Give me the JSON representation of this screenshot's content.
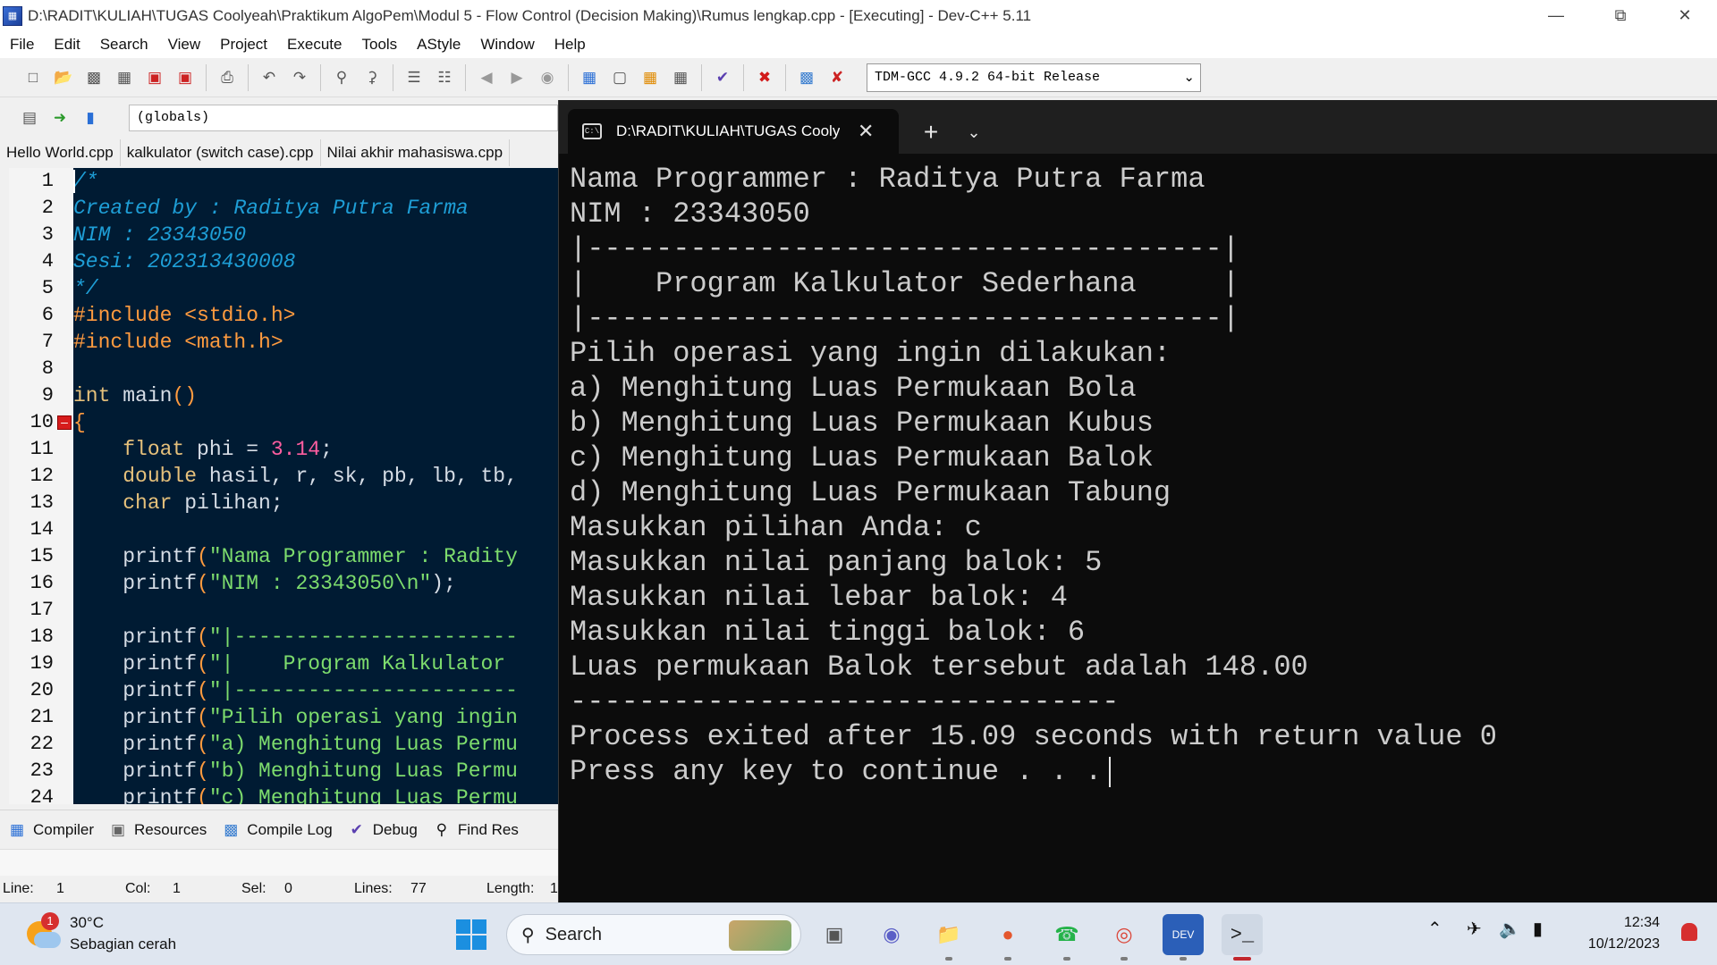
{
  "window": {
    "title": "D:\\RADIT\\KULIAH\\TUGAS Coolyeah\\Praktikum AlgoPem\\Modul 5 - Flow Control (Decision Making)\\Rumus lengkap.cpp - [Executing] - Dev-C++ 5.11"
  },
  "menu": [
    "File",
    "Edit",
    "Search",
    "View",
    "Project",
    "Execute",
    "Tools",
    "AStyle",
    "Window",
    "Help"
  ],
  "toolbar": {
    "compiler": "TDM-GCC 4.9.2 64-bit Release",
    "globals": "(globals)"
  },
  "file_tabs": [
    "Hello World.cpp",
    "kalkulator (switch case).cpp",
    "Nilai akhir mahasiswa.cpp"
  ],
  "editor": {
    "line_numbers": [
      "1",
      "2",
      "3",
      "4",
      "5",
      "6",
      "7",
      "8",
      "9",
      "10",
      "11",
      "12",
      "13",
      "14",
      "15",
      "16",
      "17",
      "18",
      "19",
      "20",
      "21",
      "22",
      "23",
      "24"
    ],
    "lines": [
      [
        {
          "t": "/*",
          "c": "c-comment"
        }
      ],
      [
        {
          "t": "Created by : Raditya Putra Farma",
          "c": "c-comment"
        }
      ],
      [
        {
          "t": "NIM : 23343050",
          "c": "c-comment"
        }
      ],
      [
        {
          "t": "Sesi: 202313430008",
          "c": "c-comment"
        }
      ],
      [
        {
          "t": "*/",
          "c": "c-comment"
        }
      ],
      [
        {
          "t": "#include <stdio.h>",
          "c": "c-pre"
        }
      ],
      [
        {
          "t": "#include <math.h>",
          "c": "c-pre"
        }
      ],
      [],
      [
        {
          "t": "int",
          "c": "c-kw"
        },
        {
          "t": " main",
          "c": "c-plain"
        },
        {
          "t": "()",
          "c": "c-pre"
        }
      ],
      [
        {
          "t": "{",
          "c": "c-pre"
        }
      ],
      [
        {
          "t": "    float",
          "c": "c-kw"
        },
        {
          "t": " phi = ",
          "c": "c-plain"
        },
        {
          "t": "3.14",
          "c": "c-num"
        },
        {
          "t": ";",
          "c": "c-plain"
        }
      ],
      [
        {
          "t": "    double",
          "c": "c-kw"
        },
        {
          "t": " hasil, r, sk, pb, lb, tb,",
          "c": "c-plain"
        }
      ],
      [
        {
          "t": "    char",
          "c": "c-kw"
        },
        {
          "t": " pilihan;",
          "c": "c-plain"
        }
      ],
      [],
      [
        {
          "t": "    printf",
          "c": "c-plain"
        },
        {
          "t": "(",
          "c": "c-pre"
        },
        {
          "t": "\"Nama Programmer : Radity",
          "c": "c-str"
        }
      ],
      [
        {
          "t": "    printf",
          "c": "c-plain"
        },
        {
          "t": "(",
          "c": "c-pre"
        },
        {
          "t": "\"NIM : 23343050\\n\"",
          "c": "c-str"
        },
        {
          "t": ");",
          "c": "c-plain"
        }
      ],
      [],
      [
        {
          "t": "    printf",
          "c": "c-plain"
        },
        {
          "t": "(",
          "c": "c-pre"
        },
        {
          "t": "\"|-----------------------",
          "c": "c-str"
        }
      ],
      [
        {
          "t": "    printf",
          "c": "c-plain"
        },
        {
          "t": "(",
          "c": "c-pre"
        },
        {
          "t": "\"|    Program Kalkulator ",
          "c": "c-str"
        }
      ],
      [
        {
          "t": "    printf",
          "c": "c-plain"
        },
        {
          "t": "(",
          "c": "c-pre"
        },
        {
          "t": "\"|-----------------------",
          "c": "c-str"
        }
      ],
      [
        {
          "t": "    printf",
          "c": "c-plain"
        },
        {
          "t": "(",
          "c": "c-pre"
        },
        {
          "t": "\"Pilih operasi yang ingin",
          "c": "c-str"
        }
      ],
      [
        {
          "t": "    printf",
          "c": "c-plain"
        },
        {
          "t": "(",
          "c": "c-pre"
        },
        {
          "t": "\"a) Menghitung Luas Permu",
          "c": "c-str"
        }
      ],
      [
        {
          "t": "    printf",
          "c": "c-plain"
        },
        {
          "t": "(",
          "c": "c-pre"
        },
        {
          "t": "\"b) Menghitung Luas Permu",
          "c": "c-str"
        }
      ],
      [
        {
          "t": "    printf",
          "c": "c-plain"
        },
        {
          "t": "(",
          "c": "c-pre"
        },
        {
          "t": "\"c) Menghitung Luas Permu",
          "c": "c-str"
        }
      ]
    ]
  },
  "bottom_tabs": [
    {
      "label": "Compiler",
      "icon": "grid-icon"
    },
    {
      "label": "Resources",
      "icon": "resources-icon"
    },
    {
      "label": "Compile Log",
      "icon": "bar-chart-icon"
    },
    {
      "label": "Debug",
      "icon": "check-icon"
    },
    {
      "label": "Find Res",
      "icon": "find-icon"
    }
  ],
  "status": {
    "line_label": "Line:",
    "line_value": "1",
    "col_label": "Col:",
    "col_value": "1",
    "sel_label": "Sel:",
    "sel_value": "0",
    "lines_label": "Lines:",
    "lines_value": "77",
    "length_label": "Length:",
    "length_value": "1"
  },
  "terminal": {
    "tab_title": "D:\\RADIT\\KULIAH\\TUGAS Coolyeah",
    "lines": [
      "Nama Programmer : Raditya Putra Farma",
      "NIM : 23343050",
      "|-------------------------------------|",
      "|    Program Kalkulator Sederhana     |",
      "|-------------------------------------|",
      "Pilih operasi yang ingin dilakukan:",
      "a) Menghitung Luas Permukaan Bola",
      "b) Menghitung Luas Permukaan Kubus",
      "c) Menghitung Luas Permukaan Balok",
      "d) Menghitung Luas Permukaan Tabung",
      "Masukkan pilihan Anda: c",
      "Masukkan nilai panjang balok: 5",
      "Masukkan nilai lebar balok: 4",
      "Masukkan nilai tinggi balok: 6",
      "Luas permukaan Balok tersebut adalah 148.00",
      "--------------------------------",
      "Process exited after 15.09 seconds with return value 0",
      "Press any key to continue . . ."
    ]
  },
  "taskbar": {
    "weather_temp": "30°C",
    "weather_desc": "Sebagian cerah",
    "weather_badge": "1",
    "search_label": "Search",
    "time": "12:34",
    "date": "10/12/2023"
  }
}
